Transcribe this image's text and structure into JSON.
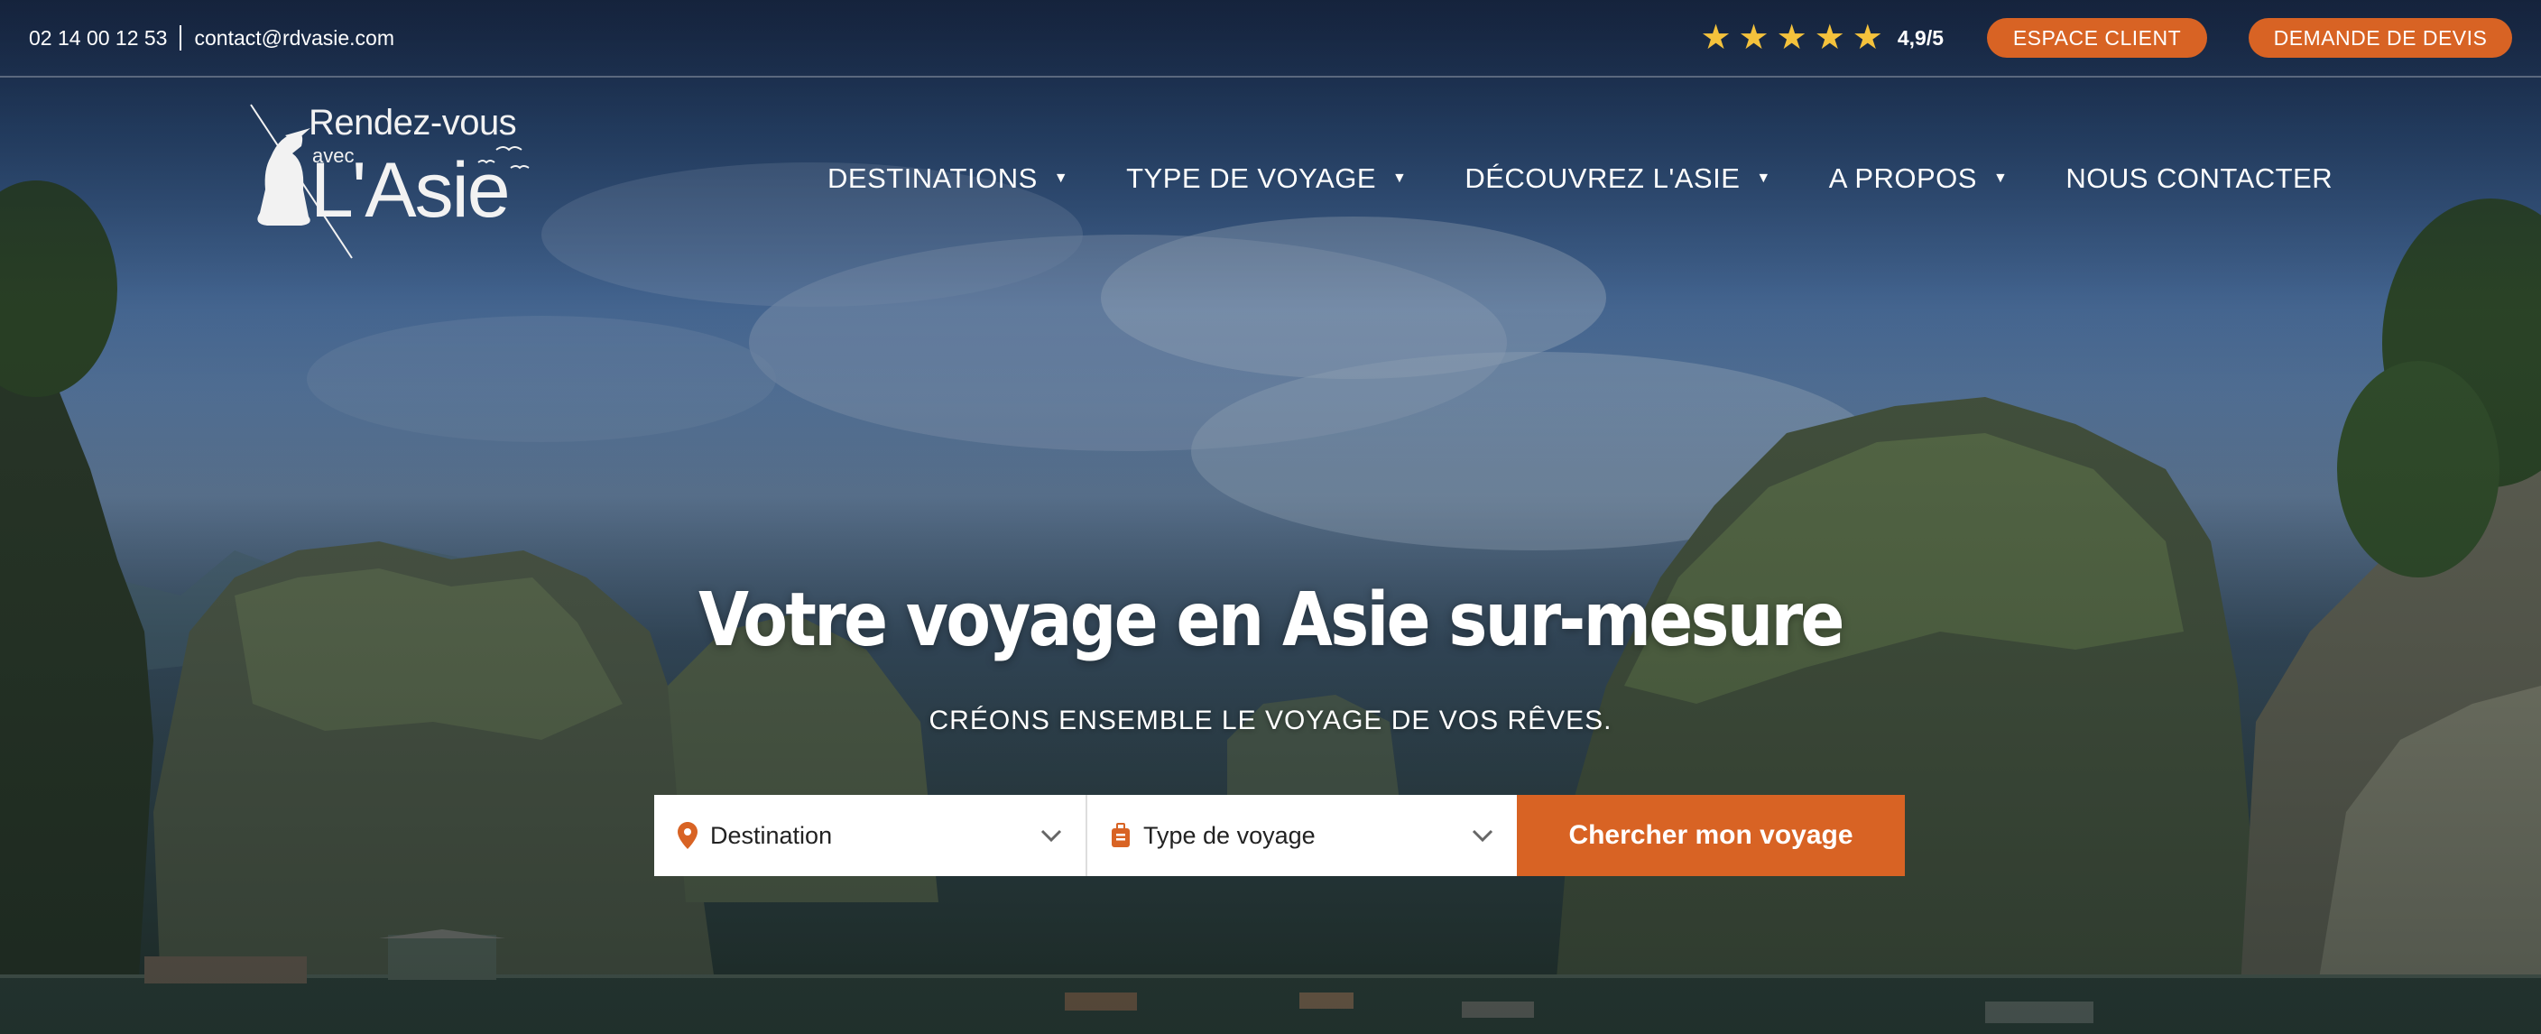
{
  "topbar": {
    "phone": "02 14 00 12 53",
    "email": "contact@rdvasie.com",
    "rating": "4,9/5",
    "stars": 5,
    "client_button": "ESPACE CLIENT",
    "quote_button": "DEMANDE DE DEVIS"
  },
  "logo": {
    "line1": "Rendez-vous",
    "line2": "avec",
    "line3": "L'Asie"
  },
  "nav": {
    "items": [
      {
        "label": "DESTINATIONS",
        "has_dropdown": true
      },
      {
        "label": "TYPE DE VOYAGE",
        "has_dropdown": true
      },
      {
        "label": "DÉCOUVREZ L'ASIE",
        "has_dropdown": true
      },
      {
        "label": "A PROPOS",
        "has_dropdown": true
      },
      {
        "label": "NOUS CONTACTER",
        "has_dropdown": false
      }
    ]
  },
  "hero": {
    "title": "Votre voyage en Asie sur-mesure",
    "subtitle": "CRÉONS ENSEMBLE LE VOYAGE DE VOS RÊVES."
  },
  "search": {
    "destination_placeholder": "Destination",
    "type_placeholder": "Type de voyage",
    "button": "Chercher mon voyage"
  },
  "colors": {
    "accent": "#d86324",
    "star": "#f4c23c",
    "text_light": "#ffffff"
  },
  "icons": {
    "destination": "map-pin-icon",
    "type": "suitcase-icon",
    "dropdown": "chevron-down-icon",
    "nav_caret": "caret-down-icon",
    "rating": "star-icon"
  }
}
